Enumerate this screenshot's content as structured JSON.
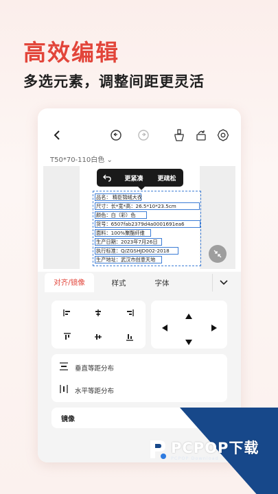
{
  "headline": "高效编辑",
  "subline": "多选元素，调整间距更灵活",
  "editor": {
    "canvas_label": "T50*70-110白色",
    "popover": {
      "tighter": "更紧凑",
      "looser": "更疏松"
    },
    "label_lines": [
      "品名：  精臣锦绒大衣",
      "尺寸：长*宽*高：26.5*10*23.5cm",
      "颜色：白（彩）色",
      "货号：6507fab2379d4a0001691ea6",
      "面料：100%聚酯纤维",
      "生产日期：2023年7月26日",
      "执行标准：Q/ZGSHJD002-2018",
      "生产地址：武汉市创意天地"
    ],
    "tabs": [
      "对齐/镜像",
      "样式",
      "字体"
    ],
    "distribute_vertical": "垂直等距分布",
    "distribute_horizontal": "水平等距分布",
    "mirror": "镜像"
  },
  "watermark": {
    "main": "PCPOP下载",
    "sub": "PCPOP Download"
  },
  "colors": {
    "accent": "#e2453a",
    "selection": "#3a7bd5",
    "watermark": "#17488a"
  }
}
